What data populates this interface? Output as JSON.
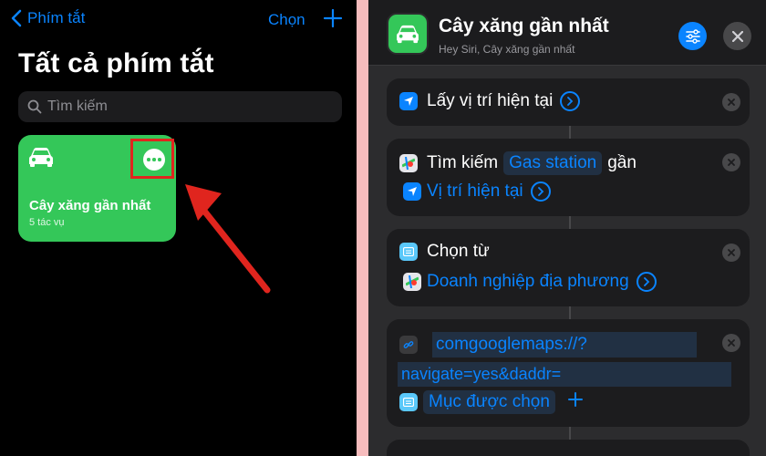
{
  "left": {
    "back_label": "Phím tắt",
    "choose_label": "Chọn",
    "title": "Tất cả phím tắt",
    "search_placeholder": "Tìm kiếm",
    "card": {
      "title": "Cây xăng gần nhất",
      "subtitle": "5 tác vụ",
      "color": "#34c759"
    },
    "highlight_color": "#e0251e"
  },
  "right": {
    "header": {
      "title": "Cây xăng gần nhất",
      "subtitle": "Hey Siri, Cây xăng gần nhất"
    },
    "actions": [
      {
        "label": "Lấy vị trí hiện tại",
        "icon": "location-arrow-icon"
      },
      {
        "prefix": "Tìm kiếm",
        "chip": "Gas station",
        "suffix": "gần",
        "sub_label": "Vị trí hiện tại",
        "icon": "maps-icon"
      },
      {
        "label": "Chọn từ",
        "sub_label": "Doanh nghiệp địa phương",
        "icon": "list-icon"
      },
      {
        "url_line1": "comgooglemaps://?",
        "url_line2": "navigate=yes&daddr=",
        "variable": "Mục được chọn",
        "icon": "link-icon"
      }
    ],
    "accent": "#0a84ff"
  }
}
